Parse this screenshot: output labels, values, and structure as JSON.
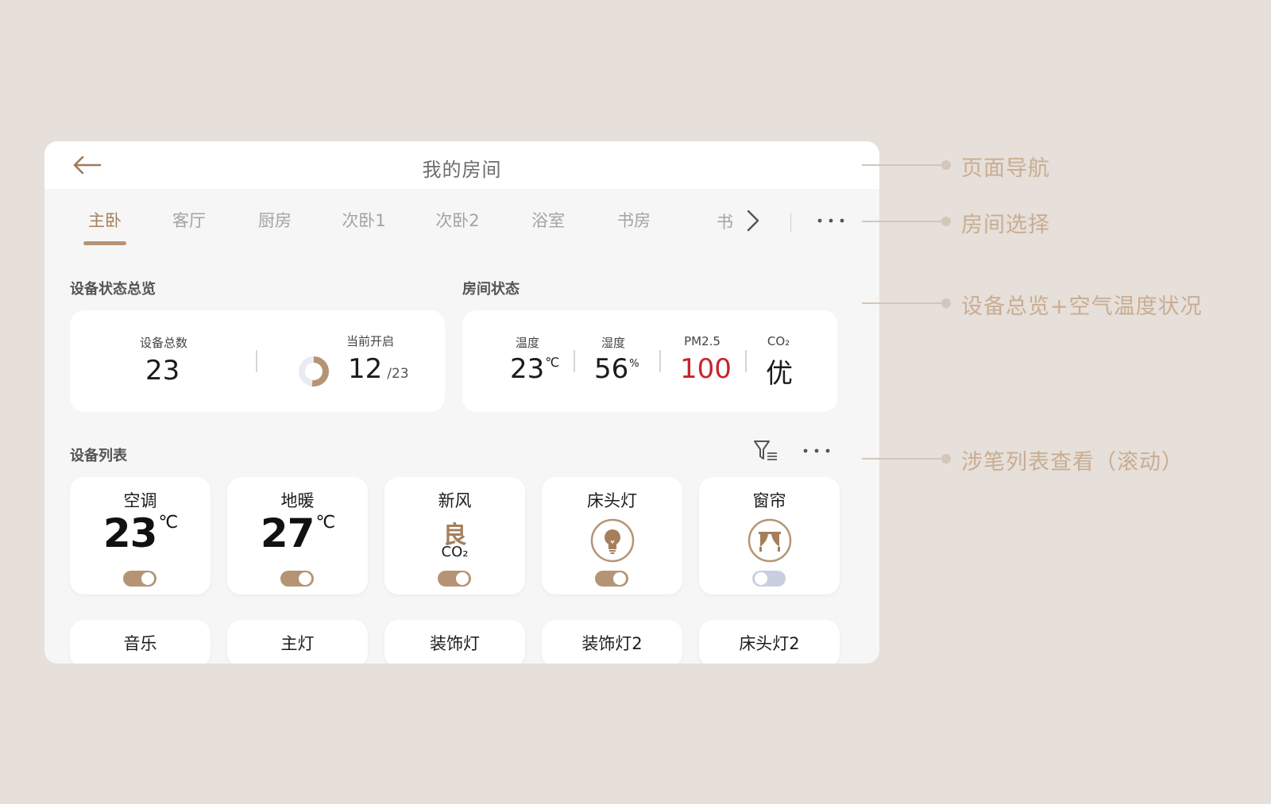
{
  "nav": {
    "title": "我的房间"
  },
  "tabs": [
    {
      "label": "主卧",
      "active": true
    },
    {
      "label": "客厅"
    },
    {
      "label": "厨房"
    },
    {
      "label": "次卧1"
    },
    {
      "label": "次卧2"
    },
    {
      "label": "浴室"
    },
    {
      "label": "书房"
    }
  ],
  "tab_overflow_text": "书",
  "overview": {
    "title": "设备状态总览",
    "total_label": "设备总数",
    "total_value": "23",
    "on_label": "当前开启",
    "on_value": "12",
    "on_total": "/23",
    "on_fraction": 0.52
  },
  "room_status": {
    "title": "房间状态",
    "temp_label": "温度",
    "temp_value": "23",
    "temp_unit": "℃",
    "humidity_label": "湿度",
    "humidity_value": "56",
    "humidity_unit": "%",
    "pm_label": "PM2.5",
    "pm_value": "100",
    "co2_label": "CO₂",
    "co2_value": "优"
  },
  "device_list": {
    "title": "设备列表",
    "devices": [
      {
        "name": "空调",
        "value": "23",
        "unit": "℃",
        "on": true
      },
      {
        "name": "地暖",
        "value": "27",
        "unit": "℃",
        "on": true
      },
      {
        "name": "新风",
        "quality": "良",
        "metric": "CO₂",
        "on": true
      },
      {
        "name": "床头灯",
        "icon": "bulb-icon",
        "on": true
      },
      {
        "name": "窗帘",
        "icon": "curtain-icon",
        "on": false
      }
    ],
    "devices_row2": [
      {
        "name": "音乐"
      },
      {
        "name": "主灯"
      },
      {
        "name": "装饰灯"
      },
      {
        "name": "装饰灯2"
      },
      {
        "name": "床头灯2"
      }
    ]
  },
  "annotations": {
    "nav": "页面导航",
    "tabs": "房间选择",
    "overview": "设备总览+空气温度状况",
    "list": "涉笔列表查看（滚动）"
  },
  "colors": {
    "accent": "#b59474",
    "accent_text": "#a57f5c",
    "alert": "#c8242b",
    "background": "#e6dfda",
    "annotation": "#c9ad91"
  }
}
